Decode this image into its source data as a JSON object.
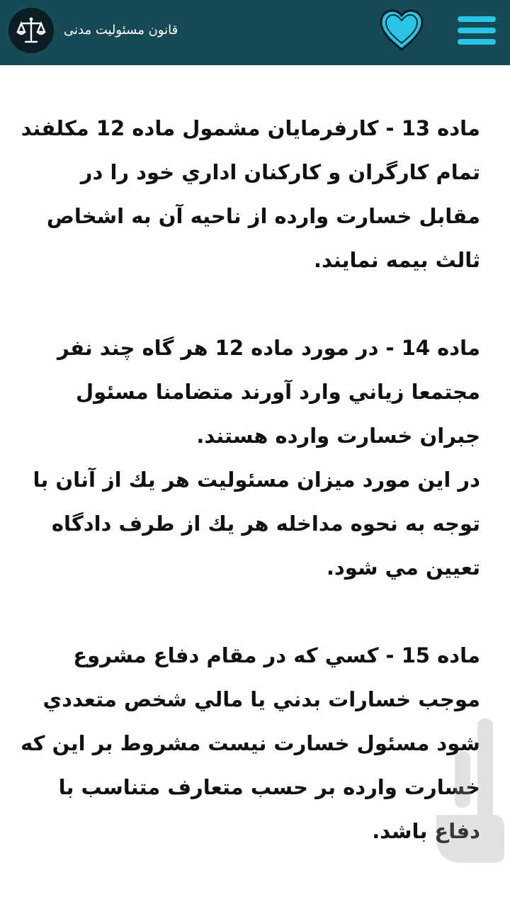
{
  "header": {
    "app_title": "قانون مسئولیت مدنی",
    "logo_icon": "scales-of-justice-icon",
    "favorite_icon": "heart-icon",
    "menu_icon": "hamburger-menu-icon",
    "colors": {
      "bar": "#174a57",
      "logo_bg": "#0c1e24",
      "accent": "#29c5e6"
    }
  },
  "articles": [
    {
      "paragraphs": [
        "ماده 13 - کارفرمایان مشمول ماده 12 مکلفند تمام کارگران و کارکنان اداري خود را در مقابل خسارت وارده از ناحیه آن به اشخاص ثالث بیمه نمایند."
      ]
    },
    {
      "paragraphs": [
        "ماده 14 - در مورد ماده 12 هر گاه چند نفر مجتمعا زیاني وارد آورند متضامنا مسئول جبران خسارت وارده هستند.",
        "در این مورد میزان مسئولیت هر یك از آنان با توجه به نحوه مداخله هر یك از طرف دادگاه تعیین مي شود."
      ]
    },
    {
      "paragraphs": [
        "ماده 15 - کسي که در مقام دفاع مشروع موجب خسارات بدني یا مالي شخص متعددي شود مسئول خسارت نیست مشروط بر این که خسارت وارده بر حسب متعارف متناسب با دفاع باشد."
      ]
    }
  ],
  "watermark_icon": "store-logo-watermark-icon"
}
